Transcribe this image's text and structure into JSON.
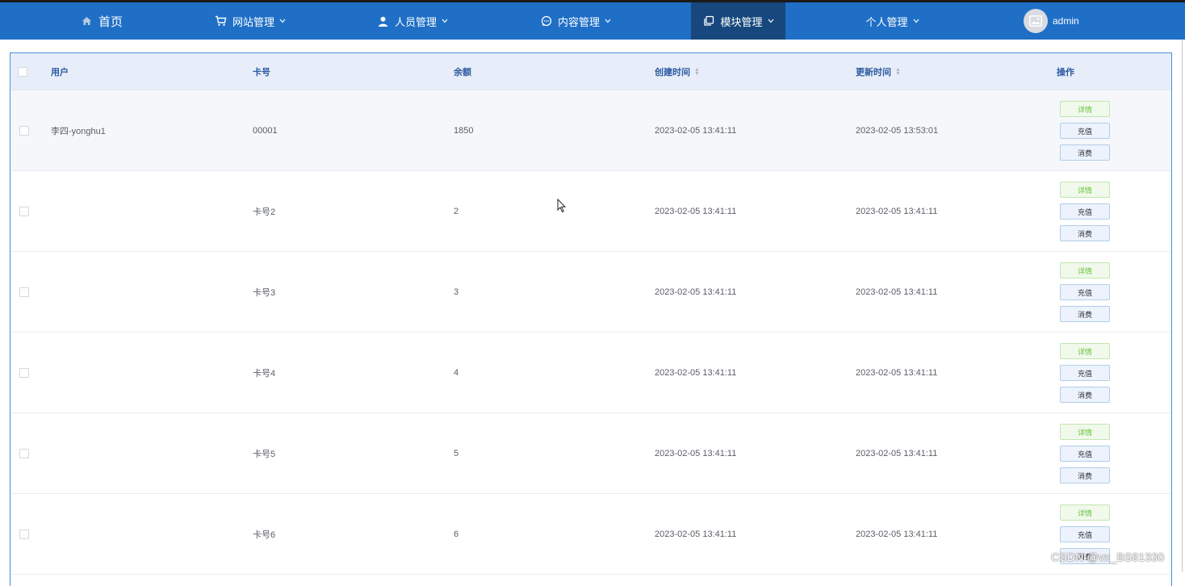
{
  "nav": {
    "home": "首页",
    "site_mgmt": "网站管理",
    "people_mgmt": "人员管理",
    "content_mgmt": "内容管理",
    "module_mgmt": "模块管理",
    "personal_mgmt": "个人管理",
    "username": "admin",
    "active": "module_mgmt"
  },
  "table": {
    "columns": {
      "user": "用户",
      "card": "卡号",
      "balance": "余额",
      "created": "创建时间",
      "updated": "更新时间",
      "ops": "操作"
    },
    "buttons": {
      "detail": "详情",
      "recharge": "充值",
      "consume": "消费"
    },
    "rows": [
      {
        "user": "李四-yonghu1",
        "card": "00001",
        "balance": "1850",
        "created": "2023-02-05 13:41:11",
        "updated": "2023-02-05 13:53:01"
      },
      {
        "user": "",
        "card": "卡号2",
        "balance": "2",
        "created": "2023-02-05 13:41:11",
        "updated": "2023-02-05 13:41:11"
      },
      {
        "user": "",
        "card": "卡号3",
        "balance": "3",
        "created": "2023-02-05 13:41:11",
        "updated": "2023-02-05 13:41:11"
      },
      {
        "user": "",
        "card": "卡号4",
        "balance": "4",
        "created": "2023-02-05 13:41:11",
        "updated": "2023-02-05 13:41:11"
      },
      {
        "user": "",
        "card": "卡号5",
        "balance": "5",
        "created": "2023-02-05 13:41:11",
        "updated": "2023-02-05 13:41:11"
      },
      {
        "user": "",
        "card": "卡号6",
        "balance": "6",
        "created": "2023-02-05 13:41:11",
        "updated": "2023-02-05 13:41:11"
      }
    ]
  },
  "watermark": "CSDN @vx_BS81330",
  "colors": {
    "navbar": "#1f6fc6",
    "nav_active": "#17487d",
    "header_bg": "#e8eef9",
    "header_text": "#2b5aa0",
    "detail_green": "#67c23a"
  }
}
